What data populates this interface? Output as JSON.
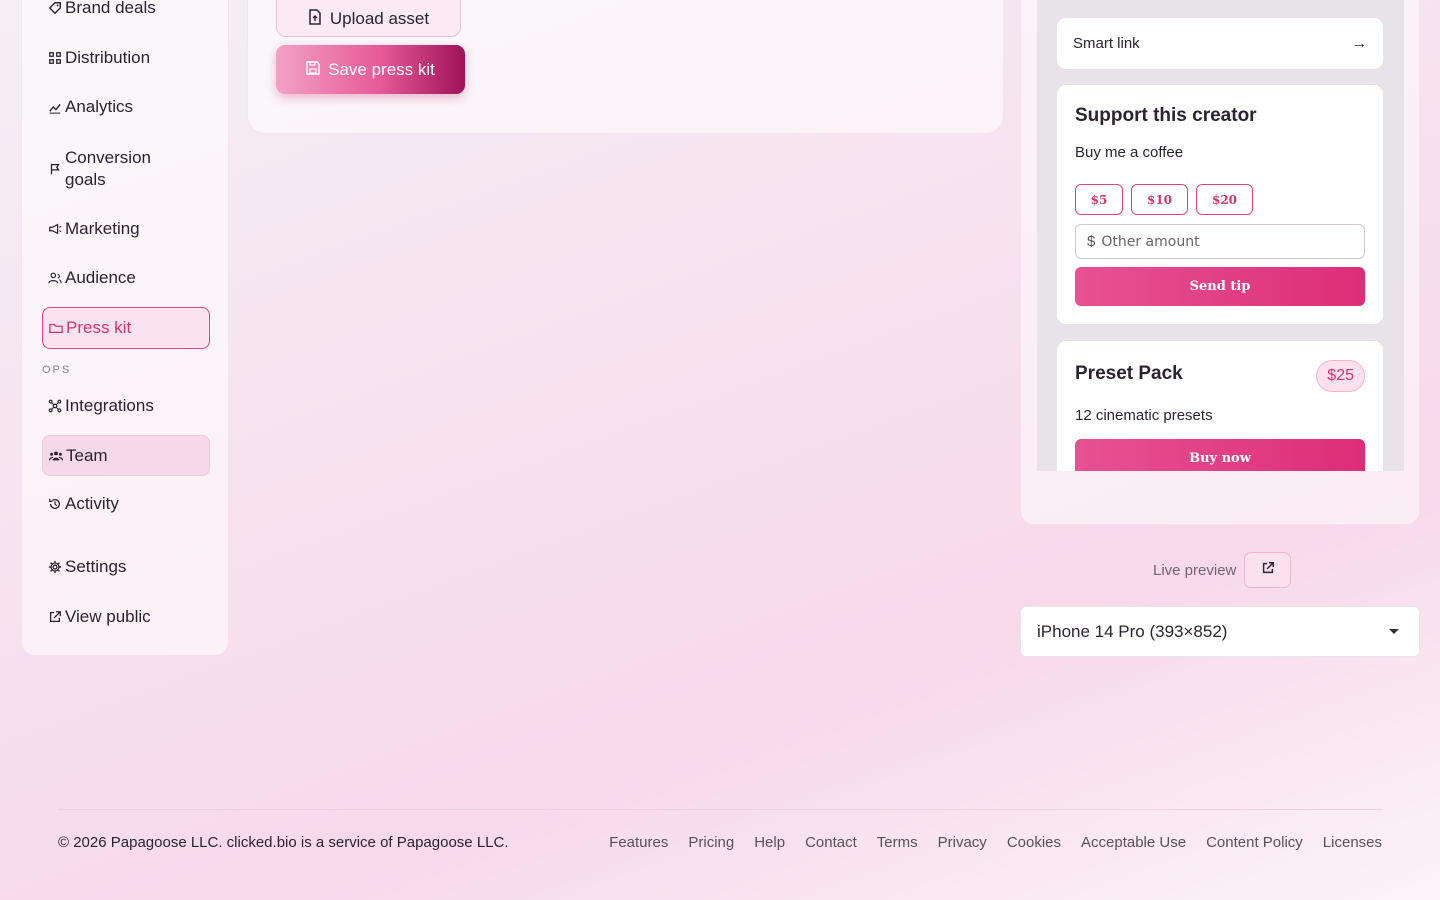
{
  "sidebar": {
    "items": [
      {
        "label": "Brand deals",
        "icon": "tag-icon"
      },
      {
        "label": "Distribution",
        "icon": "grid-icon"
      },
      {
        "label": "Analytics",
        "icon": "chart-icon"
      },
      {
        "label": "Conversion goals",
        "icon": "flag-icon"
      },
      {
        "label": "Marketing",
        "icon": "megaphone-icon"
      },
      {
        "label": "Audience",
        "icon": "users-icon"
      },
      {
        "label": "Press kit",
        "icon": "folder-icon",
        "active": true
      },
      {
        "label": "Integrations",
        "icon": "nodes-icon"
      },
      {
        "label": "Team",
        "icon": "team-icon"
      },
      {
        "label": "Activity",
        "icon": "history-icon"
      },
      {
        "label": "Settings",
        "icon": "gear-icon"
      },
      {
        "label": "View public",
        "icon": "external-link-icon"
      }
    ],
    "section_ops": "OPS"
  },
  "main": {
    "upload_label": "Upload asset",
    "save_label": "Save press kit"
  },
  "preview": {
    "smart_link": "Smart link",
    "smart_link_arrow": "→",
    "support": {
      "title": "Support this creator",
      "subtitle": "Buy me a coffee",
      "amounts": [
        "$5",
        "$10",
        "$20"
      ],
      "currency": "$",
      "other_placeholder": "Other amount",
      "send_label": "Send tip"
    },
    "preset": {
      "title": "Preset Pack",
      "price": "$25",
      "description": "12 cinematic presets",
      "buy_label": "Buy now"
    },
    "live_preview_label": "Live preview",
    "device": "iPhone 14 Pro (393×852)"
  },
  "footer": {
    "copyright": "© 2026 Papagoose LLC. clicked.bio is a service of Papagoose LLC.",
    "links": [
      "Features",
      "Pricing",
      "Help",
      "Contact",
      "Terms",
      "Privacy",
      "Cookies",
      "Acceptable Use",
      "Content Policy",
      "Licenses"
    ]
  },
  "colors": {
    "accent": "#e0457f",
    "accent_dark": "#a0125a"
  }
}
